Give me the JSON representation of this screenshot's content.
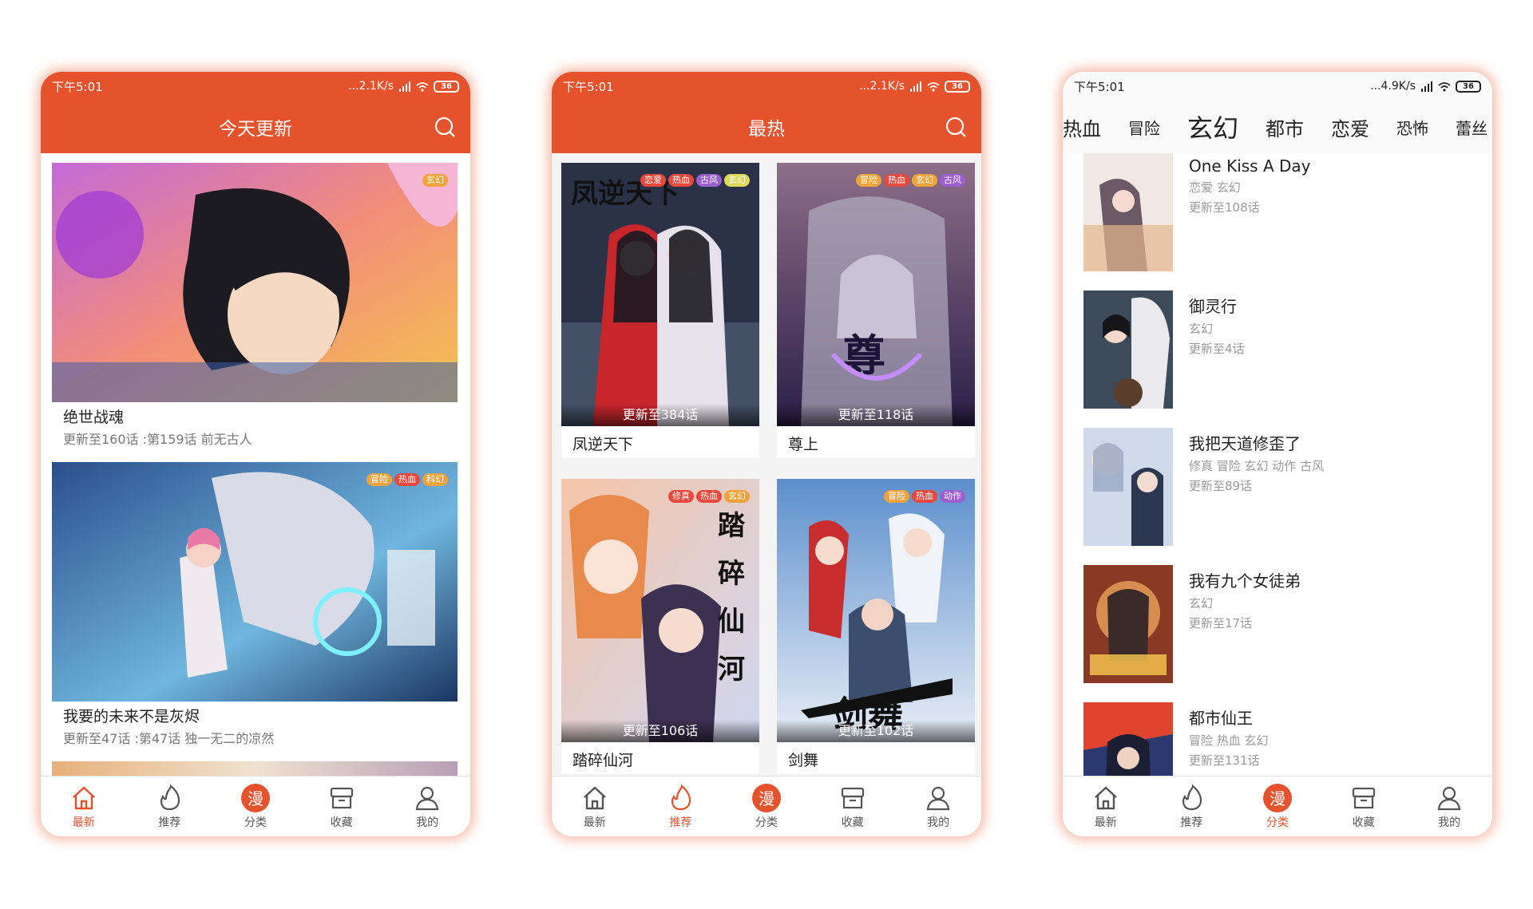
{
  "status": {
    "time": "下午5:01",
    "net_speed_1": "...2.1K/s",
    "net_speed_2": "...2.1K/s",
    "net_speed_3": "...4.9K/s",
    "battery": "36"
  },
  "phone1": {
    "header_title": "今天更新",
    "cards": [
      {
        "title": "绝世战魂",
        "subtitle": "更新至160话 :第159话  前无古人",
        "tags": [
          "玄幻"
        ]
      },
      {
        "title": "我要的未来不是灰烬",
        "subtitle": "更新至47话 :第47话 独一无二的凉然",
        "tags": [
          "冒险",
          "热血",
          "科幻"
        ]
      }
    ]
  },
  "phone2": {
    "header_title": "最热",
    "cards": [
      {
        "title": "凤逆天下",
        "episode": "更新至384话",
        "tags": [
          "恋爱",
          "热血",
          "古风",
          "玄幻"
        ]
      },
      {
        "title": "尊上",
        "episode": "更新至118话",
        "tags": [
          "冒险",
          "热血",
          "玄幻",
          "古风"
        ]
      },
      {
        "title": "踏碎仙河",
        "episode": "更新至106话",
        "tags": [
          "修真",
          "热血",
          "玄幻"
        ]
      },
      {
        "title": "剑舞",
        "episode": "更新至102话",
        "tags": [
          "冒险",
          "热血",
          "动作"
        ]
      }
    ]
  },
  "phone3": {
    "category_tabs": [
      "热血",
      "冒险",
      "玄幻",
      "都市",
      "恋爱",
      "恐怖",
      "蕾丝"
    ],
    "selected_tab": "玄幻",
    "items": [
      {
        "title": "One Kiss A Day",
        "tags": "恋爱 玄幻",
        "episode": "更新至108话"
      },
      {
        "title": "御灵行",
        "tags": "玄幻",
        "episode": "更新至4话"
      },
      {
        "title": "我把天道修歪了",
        "tags": "修真 冒险 玄幻 动作 古风",
        "episode": "更新至89话"
      },
      {
        "title": "我有九个女徒弟",
        "tags": "玄幻",
        "episode": "更新至17话"
      },
      {
        "title": "都市仙王",
        "tags": "冒险 热血 玄幻",
        "episode": "更新至131话"
      }
    ]
  },
  "nav": {
    "items": [
      "最新",
      "推荐",
      "分类",
      "收藏",
      "我的"
    ],
    "category_glyph": "漫",
    "active": [
      "最新",
      "推荐",
      "分类"
    ]
  },
  "colors": {
    "brand": "#e6522c",
    "tag_orange": "#f0a33a",
    "tag_red": "#e9483d",
    "tag_purple": "#9b5fd0"
  },
  "icons": [
    "search-icon",
    "home-icon",
    "flame-icon",
    "category-icon",
    "archive-box-icon",
    "user-icon",
    "wifi-icon",
    "signal-icon",
    "battery-icon"
  ]
}
